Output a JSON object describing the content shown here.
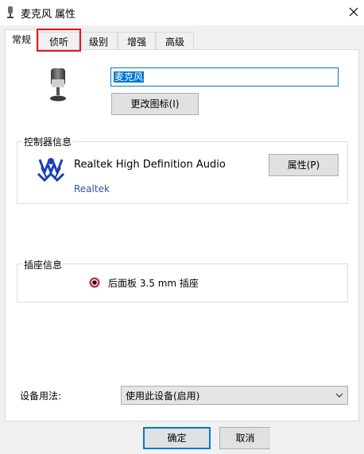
{
  "window": {
    "title": "麦克风 属性",
    "title_icon": "microphone-icon",
    "close_icon": "close-icon"
  },
  "tabs": [
    {
      "label": "常规",
      "active": true
    },
    {
      "label": "侦听",
      "active": false,
      "highlighted": true
    },
    {
      "label": "级别",
      "active": false
    },
    {
      "label": "增强",
      "active": false
    },
    {
      "label": "高级",
      "active": false
    }
  ],
  "device": {
    "icon": "microphone-icon",
    "name_value": "麦克风",
    "change_icon_button": "更改图标(I)"
  },
  "controller": {
    "group_label": "控制器信息",
    "logo": "realtek-logo",
    "name": "Realtek High Definition Audio",
    "vendor": "Realtek",
    "properties_button": "属性(P)"
  },
  "jack": {
    "group_label": "插座信息",
    "icon": "jack-dot-icon",
    "description": "后面板 3.5 mm 插座"
  },
  "usage": {
    "label": "设备用法:",
    "selected": "使用此设备(启用)"
  },
  "footer": {
    "ok_button": "确定",
    "cancel_button": "取消"
  },
  "colors": {
    "highlight": "#e0131f",
    "accent": "#0078d7",
    "vendor_link": "#2b5797",
    "jack": "#c8324a"
  }
}
